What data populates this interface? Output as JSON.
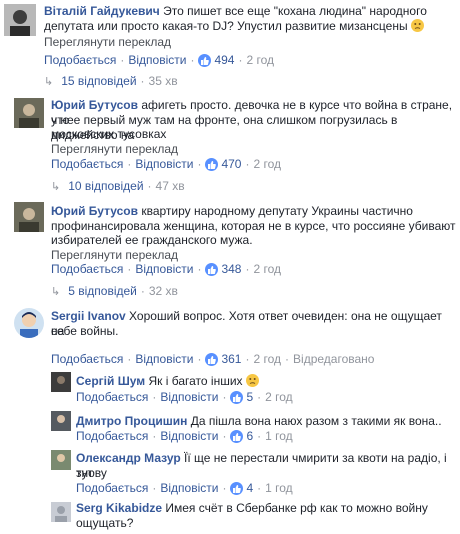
{
  "comments": [
    {
      "author": "Віталій Гайдукевич",
      "text1": "Это пишет все еще \"кохана людина\" народного",
      "text2": "депутата или просто какая-то DJ? Упустил развитие мизансцены",
      "translate": "Переглянути переклад",
      "like_label": "Подобається",
      "reply_label": "Відповісти",
      "likes": "494",
      "time": "2 год",
      "replies": "15 відповідей",
      "replies_time": "35 хв"
    },
    {
      "author": "Юрий Бутусов",
      "text1": "афигеть просто. девочка не в курсе что война в стране, что",
      "text2": "у нее первый муж там на фронте, она слишком погрузилась в диджейство на",
      "text3": "московских тусовках",
      "translate": "Переглянути переклад",
      "like_label": "Подобається",
      "reply_label": "Відповісти",
      "likes": "470",
      "time": "2 год",
      "replies": "10 відповідей",
      "replies_time": "47 хв"
    },
    {
      "author": "Юрий Бутусов",
      "text1": "квартиру народному депутату Украины частично",
      "text2": "профинансировала женщина, которая не в курсе, что россияне убивают",
      "text3": "избирателей ее гражданского мужа.",
      "translate": "Переглянути переклад",
      "like_label": "Подобається",
      "reply_label": "Відповісти",
      "likes": "348",
      "time": "2 год",
      "replies": "5 відповідей",
      "replies_time": "32 хв"
    },
    {
      "author": "Sergii Ivanov",
      "text1": "Хороший вопрос. Хотя ответ очевиден: она не ощущает на",
      "text2": "себе войны.",
      "like_label": "Подобається",
      "reply_label": "Відповісти",
      "likes": "361",
      "time": "2 год",
      "edited": "Відредаговано"
    }
  ],
  "replies": [
    {
      "author": "Сергій Шум",
      "text1": "Як і багато інших",
      "like_label": "Подобається",
      "reply_label": "Відповісти",
      "likes": "5",
      "time": "2 год"
    },
    {
      "author": "Дмитро Процишин",
      "text1": "Да пішла вона наюх разом з такими як вона..",
      "like_label": "Подобається",
      "reply_label": "Відповісти",
      "likes": "6",
      "time": "1 год"
    },
    {
      "author": "Олександр Мазур",
      "text1": "Її ще не перестали чмирити за квоти на радіо, і тут",
      "text2": "знову",
      "like_label": "Подобається",
      "reply_label": "Відповісти",
      "likes": "4",
      "time": "1 год"
    },
    {
      "author": "Serg Kikabidze",
      "text1": "Имея счёт в Сбербанке рф как то можно войну",
      "text2": "ощущать?"
    }
  ],
  "icons": {
    "like": "thumbs-up-icon",
    "reply_arrow": "reply-arrow-icon",
    "emoji": "confused-emoji-icon"
  },
  "colors": {
    "link": "#365899",
    "like_badge": "#5890ff",
    "meta": "#90949c"
  }
}
